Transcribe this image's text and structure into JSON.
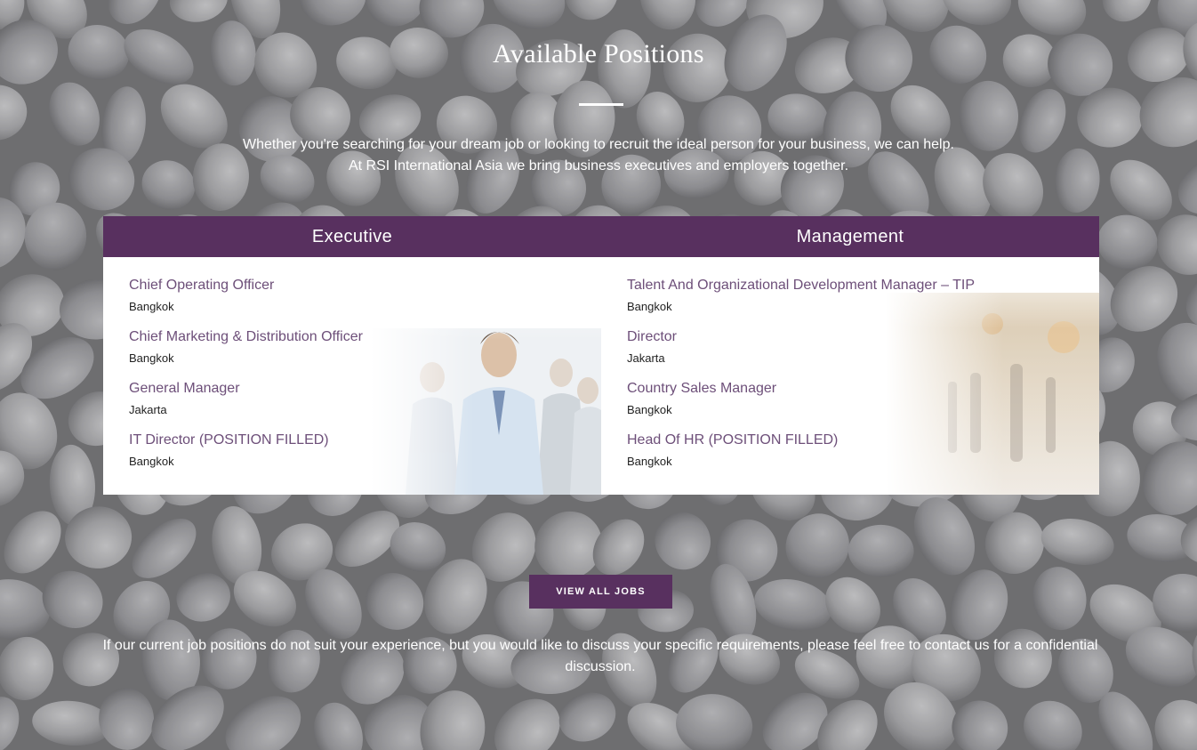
{
  "section": {
    "title": "Available Positions",
    "intro_line1": "Whether you're searching for your dream job or looking to recruit the ideal person for your business, we can help.",
    "intro_line2": "At RSI International Asia we bring business executives and employers together."
  },
  "columns": [
    {
      "heading": "Executive",
      "jobs": [
        {
          "title": "Chief Operating Officer",
          "location": "Bangkok"
        },
        {
          "title": "Chief Marketing & Distribution Officer",
          "location": "Bangkok"
        },
        {
          "title": "General Manager",
          "location": "Jakarta"
        },
        {
          "title": "IT Director (POSITION FILLED)",
          "location": "Bangkok"
        }
      ]
    },
    {
      "heading": "Management",
      "jobs": [
        {
          "title": "Talent And Organizational Development Manager – TIP",
          "location": "Bangkok"
        },
        {
          "title": "Director",
          "location": "Jakarta"
        },
        {
          "title": "Country Sales Manager",
          "location": "Bangkok"
        },
        {
          "title": "Head Of HR (POSITION FILLED)",
          "location": "Bangkok"
        }
      ]
    }
  ],
  "cta": {
    "label": "VIEW ALL JOBS"
  },
  "footnote": "If our current job positions do not suit your experience, but you would like to discuss your specific requirements, please feel free to contact us for a confidential discussion.",
  "colors": {
    "accent": "#58305f",
    "link": "#6d4f79",
    "panel": "#ffffff"
  }
}
